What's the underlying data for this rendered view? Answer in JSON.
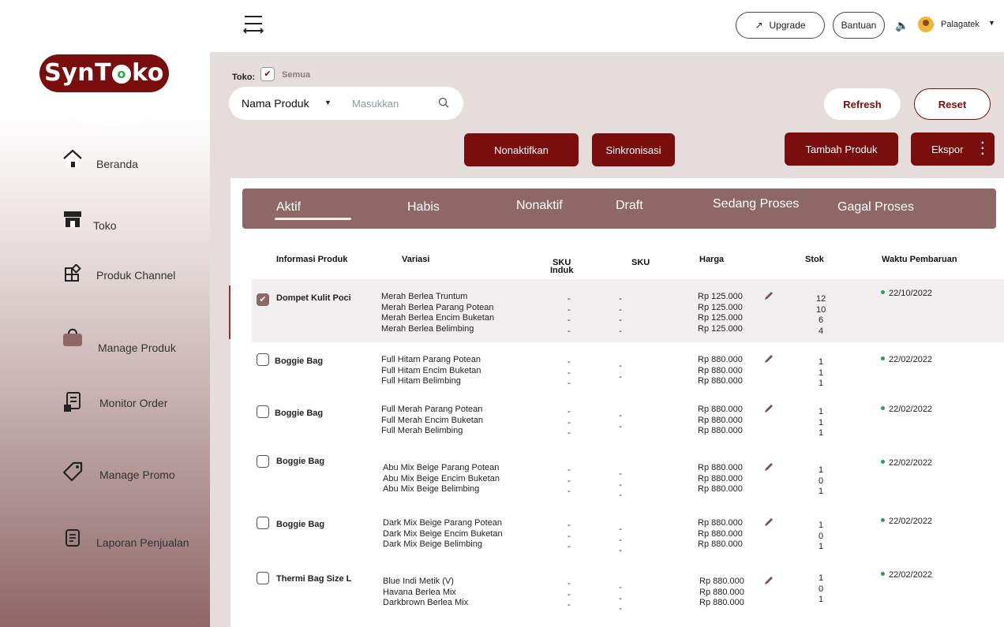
{
  "brand": {
    "name_part1": "SynT",
    "name_o": "o",
    "name_part2": "ko"
  },
  "sidebar": {
    "items": [
      {
        "label": "Beranda",
        "icon": "home-icon"
      },
      {
        "label": "Toko",
        "icon": "store-icon"
      },
      {
        "label": "Produk Channel",
        "icon": "channel-icon"
      },
      {
        "label": "Manage Produk",
        "icon": "bag-icon"
      },
      {
        "label": "Monitor Order",
        "icon": "order-icon"
      },
      {
        "label": "Manage Promo",
        "icon": "tag-icon"
      },
      {
        "label": "Laporan Penjualan",
        "icon": "report-icon"
      }
    ]
  },
  "topbar": {
    "upgrade": "Upgrade",
    "bantuan": "Bantuan",
    "user": "Palagatek"
  },
  "filters": {
    "toko_label": "Toko:",
    "semua": "Semua",
    "search_field": "Nama Produk",
    "search_placeholder": "Masukkan",
    "refresh": "Refresh",
    "reset": "Reset"
  },
  "actions": {
    "nonaktifkan": "Nonaktifkan",
    "sinkronisasi": "Sinkronisasi",
    "tambah": "Tambah Produk",
    "ekspor": "Ekspor"
  },
  "tabs": [
    "Aktif",
    "Habis",
    "Nonaktif",
    "Draft",
    "Sedang Proses",
    "Gagal Proses"
  ],
  "active_tab": "Aktif",
  "columns": {
    "info": "Informasi Produk",
    "variasi": "Variasi",
    "sku_induk": "SKU\nInduk",
    "sku": "SKU",
    "harga": "Harga",
    "stok": "Stok",
    "waktu": "Waktu Pembaruan"
  },
  "products": [
    {
      "name": "Dompet Kulit Poci",
      "checked": true,
      "variants": "Merah Berlea Truntum\nMerah Berlea Parang Potean\nMerah Berlea Encim Buketan\nMerah Berlea Belimbing",
      "sku_induk": "-\n-\n-\n-",
      "sku": "-\n-\n-\n-",
      "prices": "Rp 125.000\nRp 125.000\nRp 125.000\nRp 125.000",
      "stock": "12\n10\n6\n4",
      "date": "22/10/2022"
    },
    {
      "name": "Boggie Bag",
      "checked": false,
      "variants": "Full Hitam Parang Potean\nFull Hitam Encim Buketan\nFull Hitam Belimbing",
      "sku_induk": "-\n-\n-",
      "sku": "-\n-",
      "prices": "Rp 880.000\nRp 880.000\nRp 880.000",
      "stock": "1\n1\n1",
      "date": "22/02/2022"
    },
    {
      "name": "Boggie Bag",
      "checked": false,
      "variants": "Full Merah Parang Potean\nFull Merah Encim Buketan\nFull Merah Belimbing",
      "sku_induk": "-\n-\n-",
      "sku": "-\n-",
      "prices": "Rp 880.000\nRp 880.000\nRp 880.000",
      "stock": "1\n1\n1",
      "date": "22/02/2022"
    },
    {
      "name": "Boggie Bag",
      "checked": false,
      "variants": "Abu Mix Beige Parang Potean\nAbu Mix Beige Encim Buketan\nAbu Mix Beige Belimbing",
      "sku_induk": "-\n-\n-",
      "sku": "-\n-\n-",
      "prices": "Rp 880.000\nRp 880.000\nRp 880.000",
      "stock": "1\n0\n1",
      "date": "22/02/2022"
    },
    {
      "name": "Boggie Bag",
      "checked": false,
      "variants": "Dark Mix Beige Parang Potean\nDark Mix Beige Encim Buketan\nDark Mix Beige Belimbing",
      "sku_induk": "-\n-\n-",
      "sku": "-\n-\n-",
      "prices": "Rp 880.000\nRp 880.000\nRp 880.000",
      "stock": "1\n0\n1",
      "date": "22/02/2022"
    },
    {
      "name": "Thermi Bag Size L",
      "checked": false,
      "variants": "Blue Indi Metik (V)\nHavana Berlea Mix\nDarkbrown Berlea Mix",
      "sku_induk": "-\n-\n-",
      "sku": "-\n-\n-",
      "prices": "Rp 880.000\nRp 880.000\nRp 880.000",
      "stock": "1\n0\n1",
      "date": "22/02/2022"
    }
  ],
  "colors": {
    "primary": "#7a0e0e",
    "tabbar": "#8e6767",
    "status_dot": "#2e9b4f",
    "background": "#e5dcdc"
  }
}
